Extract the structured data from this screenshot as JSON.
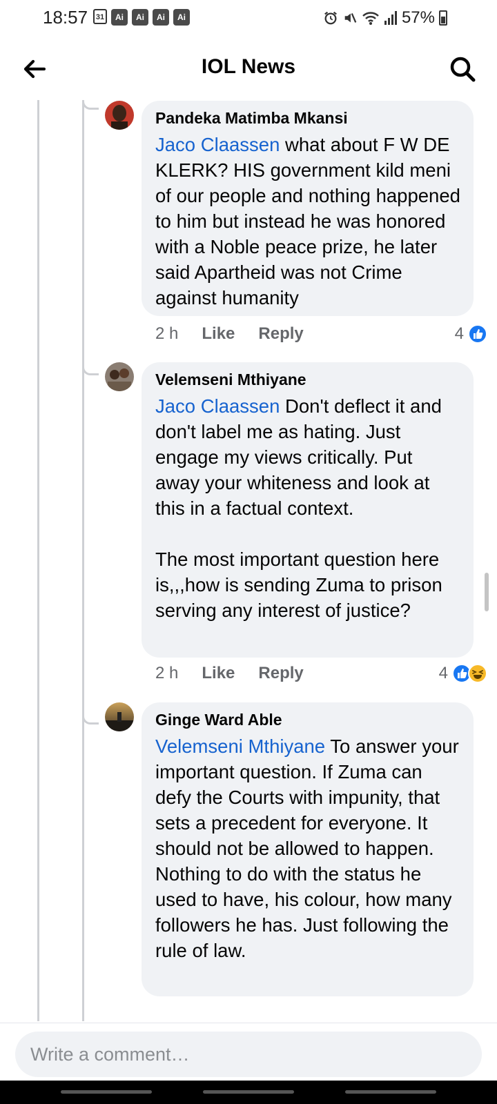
{
  "status_bar": {
    "time": "18:57",
    "calendar_day": "31",
    "ai_badges": [
      "Ai",
      "Ai",
      "Ai",
      "Ai"
    ],
    "battery": "57%",
    "icons": [
      "alarm-icon",
      "mute-icon",
      "wifi-icon",
      "signal-icon",
      "battery-icon"
    ]
  },
  "header": {
    "title": "IOL News",
    "back_icon": "arrow-left-icon",
    "search_icon": "search-icon"
  },
  "comments": [
    {
      "author": "Pandeka Matimba Mkansi",
      "mention": "Jaco Claassen",
      "text": " what about F W DE KLERK? HIS government kild meni of our people and nothing happened to him but instead he was honored with a Noble peace prize,  he later said Apartheid was not Crime against humanity",
      "time": "2 h",
      "like_label": "Like",
      "reply_label": "Reply",
      "reaction_count": "4",
      "reactions": [
        "like"
      ]
    },
    {
      "author": "Velemseni Mthiyane",
      "mention": "Jaco Claassen",
      "text": " Don't deflect it and don't label me as hating. Just engage my views critically. Put away your whiteness and look at this in a factual context.\n\nThe most important question here is,,,how is sending Zuma to prison serving any interest of justice?",
      "time": "2 h",
      "like_label": "Like",
      "reply_label": "Reply",
      "reaction_count": "4",
      "reactions": [
        "like",
        "haha"
      ]
    },
    {
      "author": "Ginge Ward Able",
      "mention": "Velemseni Mthiyane",
      "text": " To answer your important question. If Zuma can defy the Courts with impunity, that sets a precedent for everyone. It should not be allowed to happen. Nothing to do with the status he used to have, his colour, how many followers he has. Just following the rule of law."
    }
  ],
  "composer": {
    "placeholder": "Write a comment…"
  },
  "colors": {
    "mention": "#1763cf",
    "bubble": "#f0f2f5",
    "meta_text": "#65676b",
    "like_blue": "#1877f2",
    "haha_yellow": "#f7b928"
  }
}
